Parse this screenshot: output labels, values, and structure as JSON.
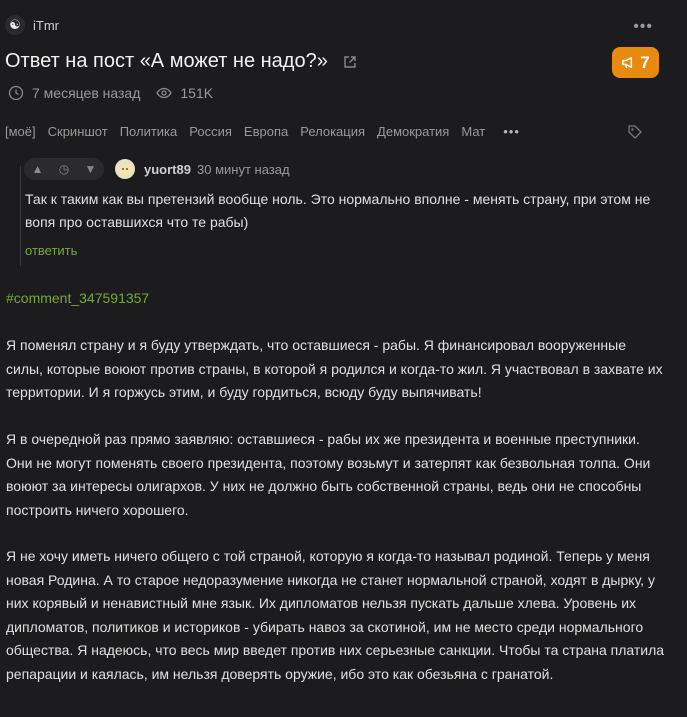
{
  "header": {
    "author": "iTmr",
    "more_label": "•••",
    "title": "Ответ на пост «А может не надо?»",
    "rating": "7",
    "rating_color": "#e88a0f",
    "time_ago": "7 месяцев назад",
    "views": "151K"
  },
  "tags": [
    "[моё]",
    "Скриншот",
    "Политика",
    "Россия",
    "Европа",
    "Релокация",
    "Демократия",
    "Мат"
  ],
  "tags_more": "•••",
  "comment": {
    "user": "yuort89",
    "time": "30 минут назад",
    "text": "Так к таким как вы претензий вообще ноль. Это нормально вполне - менять страну, при этом не вопя про оставшихся что те рабы)",
    "reply_label": "ответить",
    "accent_color": "#76a83a"
  },
  "post": {
    "hashtag": "#comment_347591357",
    "paragraphs": [
      "Я поменял страну и я буду утверждать, что оставшиеся - рабы. Я финансировал вооруженные силы, которые воюют против страны, в которой я родился и когда-то жил. Я участвовал в захвате их территории. И я горжусь этим, и буду гордиться, всюду буду выпячивать!",
      "Я в очередной раз прямо заявляю: оставшиеся - рабы их же президента и военные преступники. Они не могут поменять своего президента, поэтому возьмут и затерпят как безвольная толпа. Они воюют за интересы олигархов. У них не должно быть собственной страны, ведь они не способны построить ничего хорошего.",
      "Я не хочу иметь ничего общего с той страной, которую я когда-то называл родиной. Теперь у меня новая Родина. А то старое недоразумение никогда не станет нормальной страной, ходят в дырку, у них корявый и ненавистный мне язык. Их дипломатов нельзя пускать дальше хлева. Уровень их дипломатов, политиков и историков - убирать навоз за скотиной, им не место среди нормального общества. Я надеюсь, что весь мир введет против них серьезные санкции. Чтобы та страна платила репарации и каялась, им нельзя доверять оружие, ибо это как обезьяна с гранатой."
    ]
  }
}
